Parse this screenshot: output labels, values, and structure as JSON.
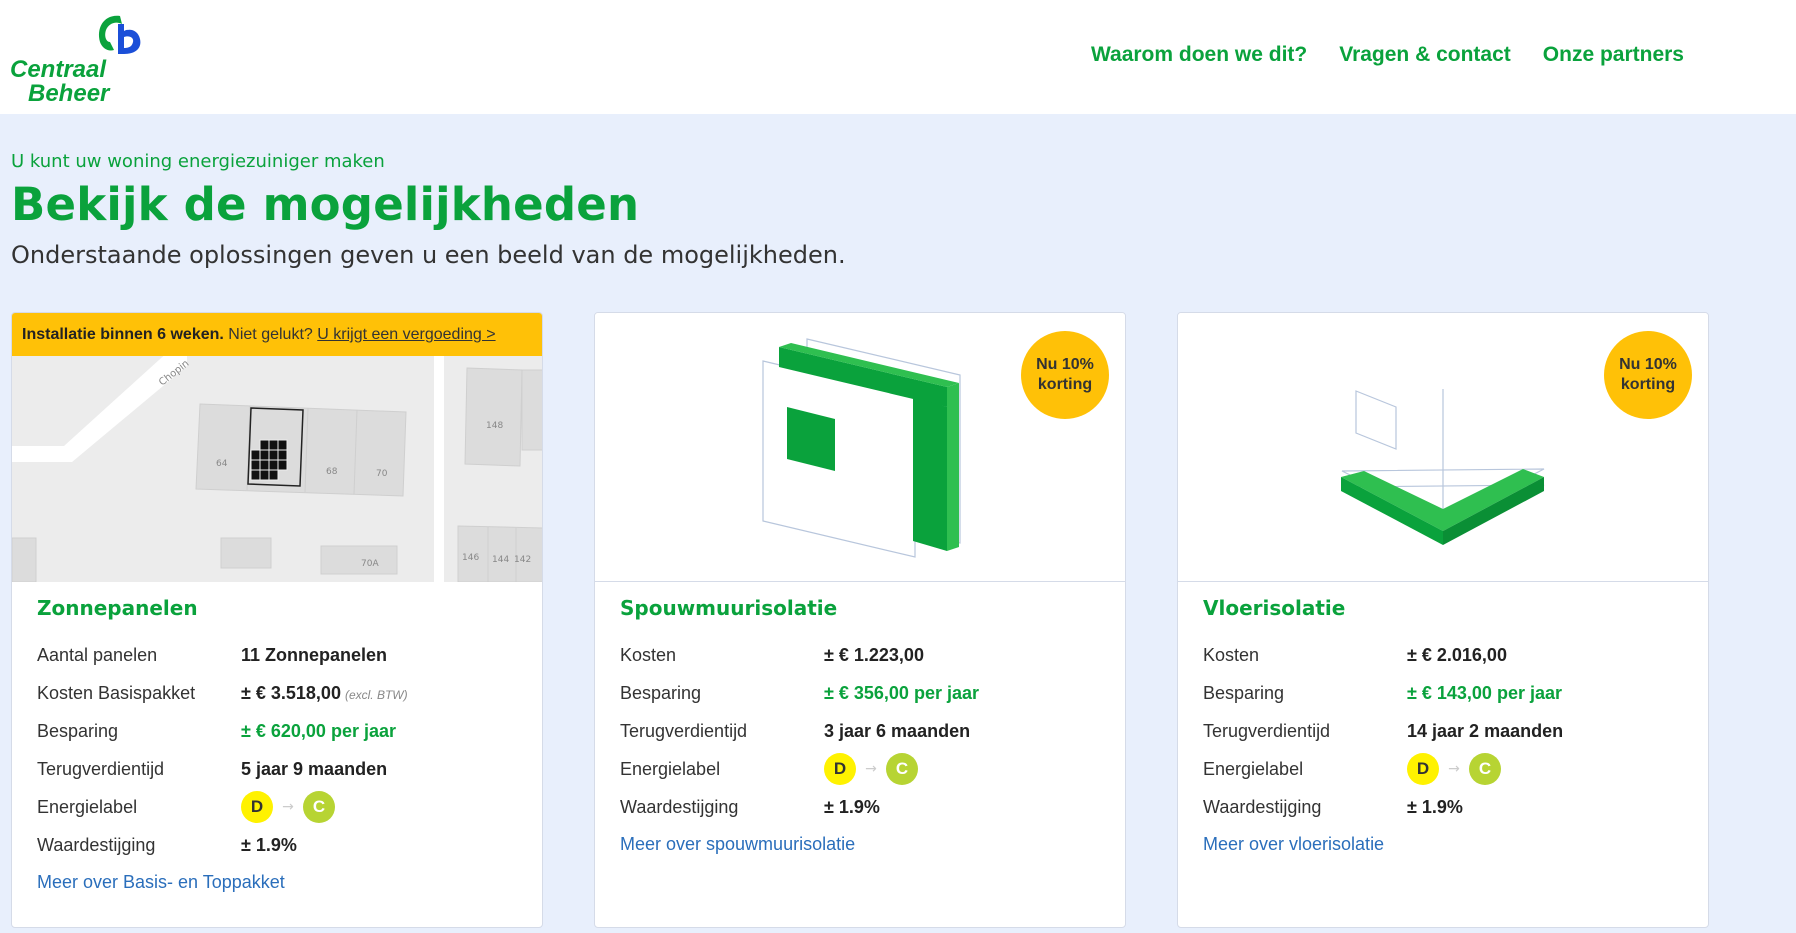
{
  "brand": {
    "line1": "Centraal",
    "line2": "Beheer"
  },
  "nav": [
    {
      "label": "Waarom doen we dit?"
    },
    {
      "label": "Vragen & contact"
    },
    {
      "label": "Onze partners"
    }
  ],
  "intro": {
    "kicker": "U kunt uw woning energiezuiniger maken",
    "title": "Bekijk de mogelijkheden",
    "subtitle": "Onderstaande oplossingen geven u een beeld van de mogelijkheden."
  },
  "colors": {
    "accent": "#0aa23c",
    "badge": "#ffc107",
    "link": "#2a6ebb"
  },
  "cards": [
    {
      "banner_bold": "Installatie binnen 6 weken.",
      "banner_text": "Niet gelukt?",
      "banner_link": "U krijgt een vergoeding >",
      "map_labels": [
        "Chopin",
        "64",
        "68",
        "70",
        "148",
        "146",
        "144",
        "142",
        "70A"
      ],
      "title": "Zonnepanelen",
      "rows": [
        {
          "label": "Aantal panelen",
          "value": "11 Zonnepanelen"
        },
        {
          "label": "Kosten Basispakket",
          "value": "± € 3.518,00",
          "note": "(excl. BTW)"
        },
        {
          "label": "Besparing",
          "value": "± € 620,00 per jaar"
        },
        {
          "label": "Terugverdientijd",
          "value": "5 jaar 9 maanden"
        }
      ],
      "energy_label": {
        "label": "Energielabel",
        "from": "D",
        "to": "C",
        "arrow": "→"
      },
      "value_rise": {
        "label": "Waardestijging",
        "value": "± 1.9%"
      },
      "link": "Meer over Basis- en Toppakket"
    },
    {
      "badge": "Nu 10% korting",
      "title": "Spouwmuurisolatie",
      "rows": [
        {
          "label": "Kosten",
          "value": "± € 1.223,00"
        },
        {
          "label": "Besparing",
          "value": "± € 356,00 per jaar"
        },
        {
          "label": "Terugverdientijd",
          "value": "3 jaar 6 maanden"
        }
      ],
      "energy_label": {
        "label": "Energielabel",
        "from": "D",
        "to": "C",
        "arrow": "→"
      },
      "value_rise": {
        "label": "Waardestijging",
        "value": "± 1.9%"
      },
      "link": "Meer over spouwmuurisolatie"
    },
    {
      "badge": "Nu 10% korting",
      "title": "Vloerisolatie",
      "rows": [
        {
          "label": "Kosten",
          "value": "± € 2.016,00"
        },
        {
          "label": "Besparing",
          "value": "± € 143,00 per jaar"
        },
        {
          "label": "Terugverdientijd",
          "value": "14 jaar 2 maanden"
        }
      ],
      "energy_label": {
        "label": "Energielabel",
        "from": "D",
        "to": "C",
        "arrow": "→"
      },
      "value_rise": {
        "label": "Waardestijging",
        "value": "± 1.9%"
      },
      "link": "Meer over vloerisolatie"
    }
  ]
}
